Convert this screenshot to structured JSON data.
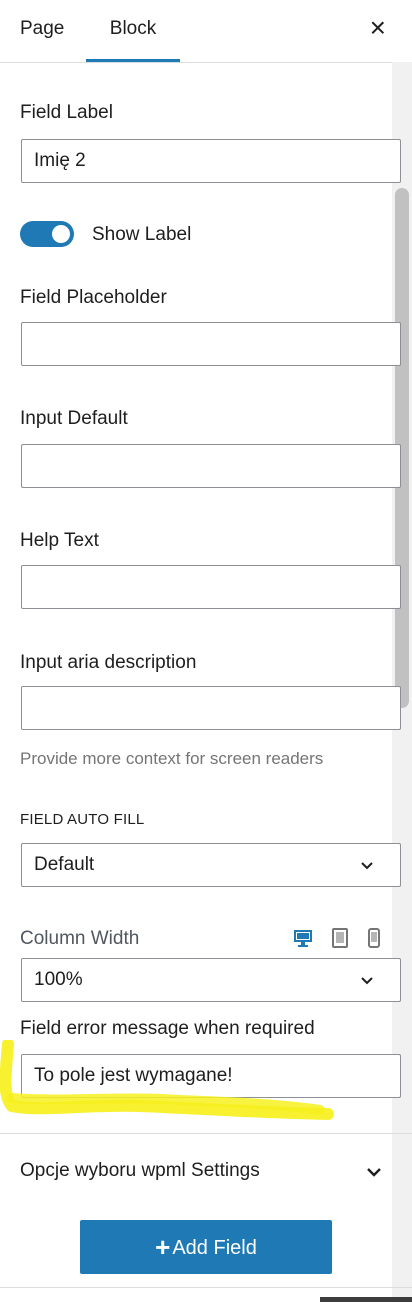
{
  "tabs": {
    "page": "Page",
    "block": "Block",
    "active": "block"
  },
  "close_label": "×",
  "fields": {
    "field_label": {
      "label": "Field Label",
      "value": "Imię 2"
    },
    "show_label": {
      "label": "Show Label",
      "on": true
    },
    "field_placeholder": {
      "label": "Field Placeholder",
      "value": ""
    },
    "input_default": {
      "label": "Input Default",
      "value": ""
    },
    "help_text": {
      "label": "Help Text",
      "value": ""
    },
    "aria_description": {
      "label": "Input aria description",
      "value": "",
      "help": "Provide more context for screen readers"
    },
    "auto_fill": {
      "label": "FIELD AUTO FILL",
      "value": "Default"
    },
    "column_width": {
      "label": "Column Width",
      "value": "100%",
      "devices": [
        "desktop-icon",
        "tablet-icon",
        "mobile-icon"
      ]
    },
    "error_message": {
      "label": "Field error message when required",
      "value": "To pole jest wymagane!"
    }
  },
  "wpml_panel": {
    "title": "Opcje wyboru wpml Settings"
  },
  "add_field_button": {
    "icon": "plus-icon",
    "label": "Add Field"
  },
  "colors": {
    "accent": "#1e79b5",
    "highlight": "#f7f01e",
    "border": "#8c8f94",
    "muted": "#757575"
  }
}
